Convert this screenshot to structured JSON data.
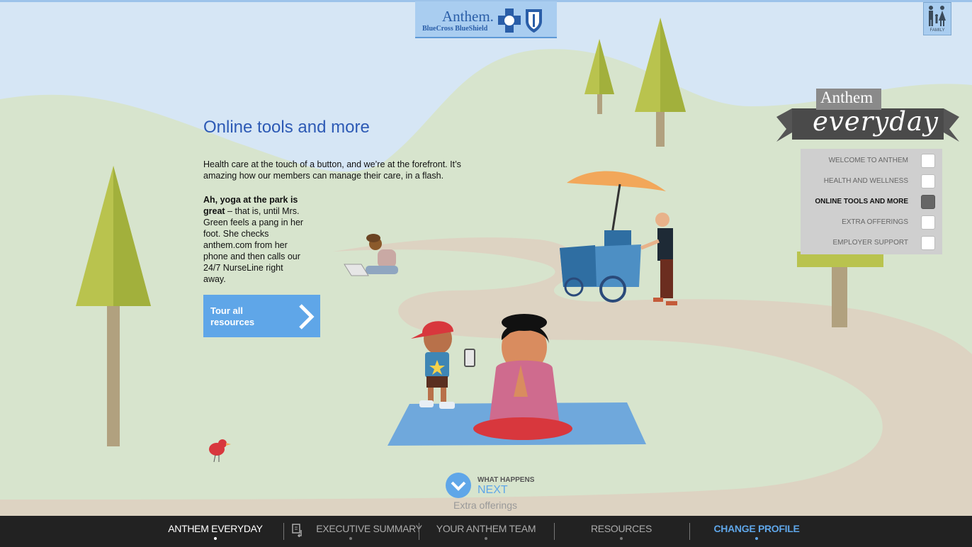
{
  "brand": {
    "name": "Anthem.",
    "subtitle": "BlueCross BlueShield"
  },
  "profile": {
    "label": "FAMILY"
  },
  "section": {
    "title": "Online tools and more",
    "intro": "Health care at the touch of a button, and we’re at the forefront. It’s amazing how our members can manage their care, in a flash.",
    "story_bold": "Ah, yoga at the park is great",
    "story_rest": " – that is, until Mrs. Green feels a pang in her foot. She checks anthem.com from her phone and then calls our 24/7 NurseLine right away.",
    "cta_label": "Tour all resources"
  },
  "everyday": {
    "anthem": "Anthem",
    "everyday": "everyday",
    "items": [
      {
        "label": "WELCOME TO ANTHEM",
        "active": false
      },
      {
        "label": "HEALTH AND WELLNESS",
        "active": false
      },
      {
        "label": "ONLINE TOOLS AND MORE",
        "active": true
      },
      {
        "label": "EXTRA OFFERINGS",
        "active": false
      },
      {
        "label": "EMPLOYER SUPPORT",
        "active": false
      }
    ]
  },
  "next": {
    "what": "WHAT HAPPENS",
    "next": "NEXT",
    "subtitle": "Extra offerings"
  },
  "nav": {
    "items": [
      {
        "label": "ANTHEM EVERYDAY",
        "state": "current"
      },
      {
        "label": "EXECUTIVE SUMMARY",
        "state": "normal"
      },
      {
        "label": "YOUR ANTHEM TEAM",
        "state": "normal"
      },
      {
        "label": "RESOURCES",
        "state": "normal"
      },
      {
        "label": "CHANGE PROFILE",
        "state": "highlight"
      }
    ]
  },
  "colors": {
    "sky": "#d6e6f5",
    "hill": "#d7e4cd",
    "path": "#ddd3c2",
    "accent_blue": "#5fa6e8",
    "title_blue": "#2d5ab5",
    "nav_bg": "#222222",
    "menu_bg": "#cfcfcf"
  }
}
